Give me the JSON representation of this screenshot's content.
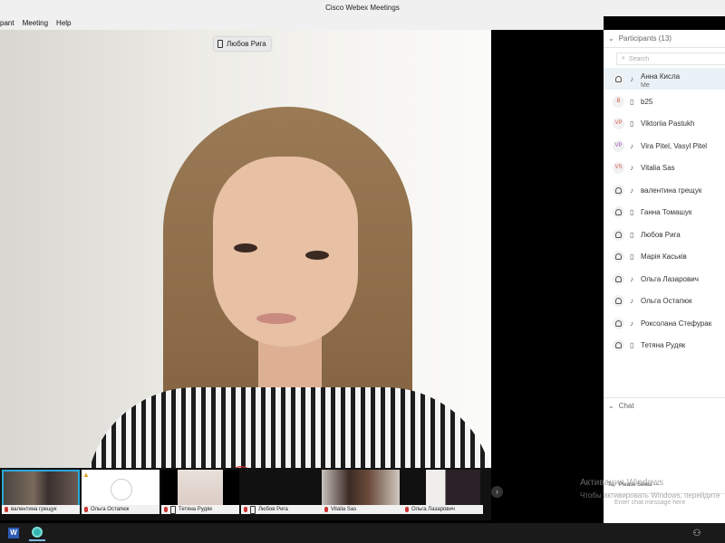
{
  "window": {
    "title": "Cisco Webex Meetings"
  },
  "menu": {
    "items": [
      "pant",
      "Meeting",
      "Help"
    ]
  },
  "main_video": {
    "speaker_name": "Любов Рига"
  },
  "filmstrip": {
    "tiles": [
      {
        "name": "валентина грещук"
      },
      {
        "name": "Ольга Остапюк"
      },
      {
        "name": "Тетяна Рудяк"
      },
      {
        "name": "Любов Рига"
      },
      {
        "name": "Vitalia Sas"
      },
      {
        "name": "Ольга Лазарович"
      }
    ]
  },
  "participants": {
    "title": "Participants (13)",
    "search_placeholder": "Search",
    "items": [
      {
        "name": "Анна Кисла",
        "sub": "Me",
        "avatar": "person-icon"
      },
      {
        "name": "b25",
        "avatar": "B"
      },
      {
        "name": "Viktoriia Pastukh",
        "avatar": "VP"
      },
      {
        "name": "Vira Pitel, Vasyl Pitel",
        "avatar": "VP"
      },
      {
        "name": "Vitalia Sas",
        "avatar": "VS"
      },
      {
        "name": "валентина грещук",
        "avatar": "person-icon"
      },
      {
        "name": "Ганна Томашук",
        "avatar": "person-icon"
      },
      {
        "name": "Любов Рига",
        "avatar": "person-icon"
      },
      {
        "name": "Марія Каськів",
        "avatar": "person-icon"
      },
      {
        "name": "Ольга Лазарович",
        "avatar": "person-icon"
      },
      {
        "name": "Ольга Остапюк",
        "avatar": "person-icon"
      },
      {
        "name": "Роксолана Стефурак",
        "avatar": "person-icon"
      },
      {
        "name": "Тетяна Рудяк",
        "avatar": "person-icon"
      }
    ]
  },
  "chat": {
    "title": "Chat",
    "to_label": "To:",
    "to_value": "Please Select ---",
    "input_placeholder": "Enter chat message here"
  },
  "watermark": {
    "line1": "Активация Windows",
    "line2": "Чтобы активировать Windows, перейдите"
  },
  "taskbar": {
    "word_letter": "W"
  }
}
